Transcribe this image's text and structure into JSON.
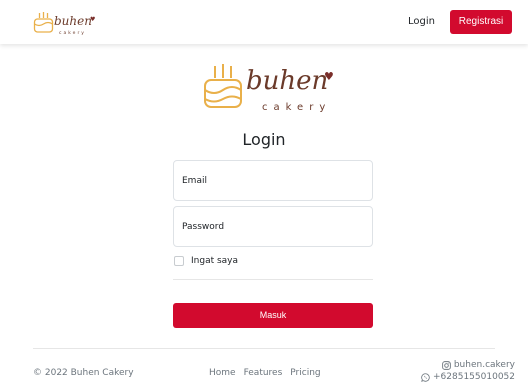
{
  "brand": {
    "name": "buhen",
    "tagline": "cakery",
    "color": "#6b3a2a",
    "accent": "#e9b04a",
    "heart": "#7a2e2a"
  },
  "nav": {
    "login_label": "Login",
    "register_label": "Registrasi",
    "accent": "#d20a2e"
  },
  "form": {
    "title": "Login",
    "email_placeholder": "Email",
    "password_placeholder": "Password",
    "remember_label": "Ingat saya",
    "submit_label": "Masuk"
  },
  "footer": {
    "copyright": "© 2022 Buhen Cakery",
    "links": [
      "Home",
      "Features",
      "Pricing"
    ],
    "instagram": "buhen.cakery",
    "whatsapp": "+6285155010052",
    "instagram_icon": "instagram-icon",
    "whatsapp_icon": "whatsapp-icon"
  }
}
